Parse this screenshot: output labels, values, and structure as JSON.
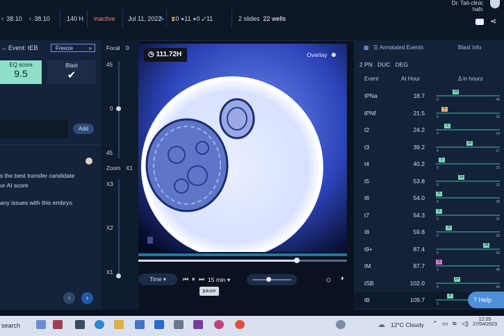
{
  "topbar": {
    "stat1": "38.10",
    "stat2": "38.10",
    "hours": "140 H",
    "status": "inactive",
    "date": "Jul 11, 2022",
    "counts": [
      "0",
      "11",
      "0",
      "11"
    ],
    "slides": "2 slides",
    "wells": "22 wells",
    "clinic": "Dr. Tait-clinic",
    "user": "hafc"
  },
  "left": {
    "event_label": "Event: tEB",
    "freeze": "Freeze",
    "eq_title": "EQ score",
    "eq_value": "9.5",
    "blast_title": "Blast",
    "add": "Add",
    "line1": "s the best transfer candidate",
    "line2": "ur AI score",
    "line3": "any issues with this embryo"
  },
  "focal": {
    "focal_label": "Focal",
    "focal_value": "0",
    "ticks": [
      "45",
      "0",
      "45"
    ],
    "zoom_label": "Zoom",
    "zoom_value": "X1",
    "zoom_ticks": [
      "X3",
      "X2",
      "X1"
    ]
  },
  "viewer": {
    "time": "111.72H",
    "overlay": "Overlay",
    "progress_fraction": 0.76
  },
  "controls": {
    "time_mode": "Time",
    "interval": "15 min",
    "tooltip": "pause"
  },
  "events_panel": {
    "tab_annotated": "Annotated Events",
    "tab_blast": "Blast Info",
    "filter_pn": "2 PN",
    "filter_duc": "DUC",
    "filter_deg": "DEG",
    "col_event": "Event",
    "col_hour": "At Hour",
    "col_delta": "Δ in hours",
    "rows": [
      {
        "event": "tPNa",
        "hour": "18.7",
        "tag": "13",
        "min": "0",
        "max": "45",
        "pos": 0.3,
        "color": "#78d6b6"
      },
      {
        "event": "tPNf",
        "hour": "21.5",
        "tag": "5",
        "min": "0",
        "max": "30",
        "pos": 0.1,
        "color": "#e0b070"
      },
      {
        "event": "t2",
        "hour": "24.2",
        "tag": "3",
        "min": "0",
        "max": "14",
        "pos": 0.15,
        "color": "#78d6b6"
      },
      {
        "event": "t3",
        "hour": "39.2",
        "tag": "15",
        "min": "0",
        "max": "27",
        "pos": 0.55,
        "color": "#78d6b6"
      },
      {
        "event": "t4",
        "hour": "40.2",
        "tag": "1",
        "min": "0",
        "max": "23",
        "pos": 0.05,
        "color": "#78d6b6"
      },
      {
        "event": "t5",
        "hour": "53.8",
        "tag": "14",
        "min": "0",
        "max": "33",
        "pos": 0.4,
        "color": "#78d6b6"
      },
      {
        "event": "t6",
        "hour": "54.0",
        "tag": "0",
        "min": "0",
        "max": "28",
        "pos": 0.0,
        "color": "#78d6b6"
      },
      {
        "event": "t7",
        "hour": "54.3",
        "tag": "0",
        "min": "0",
        "max": "31",
        "pos": 0.0,
        "color": "#78d6b6"
      },
      {
        "event": "t8",
        "hour": "59.8",
        "tag": "6",
        "min": "0",
        "max": "32",
        "pos": 0.18,
        "color": "#78d6b6"
      },
      {
        "event": "t9+",
        "hour": "87.4",
        "tag": "28",
        "min": "0",
        "max": "33",
        "pos": 0.85,
        "color": "#78d6b6"
      },
      {
        "event": "tM",
        "hour": "87.7",
        "tag": "0",
        "min": "0",
        "max": "48",
        "pos": 0.0,
        "color": "#d878c8"
      },
      {
        "event": "tSB",
        "hour": "102.0",
        "tag": "14",
        "min": "0",
        "max": "44",
        "pos": 0.32,
        "color": "#78d6b6"
      },
      {
        "event": "tB",
        "hour": "109.7",
        "tag": "8",
        "min": "0",
        "max": "",
        "pos": 0.2,
        "color": "#78d6b6"
      }
    ],
    "help": "Help"
  },
  "taskbar": {
    "search": "search",
    "weather": "12°C Cloudy",
    "time": "12:05",
    "date": "27/04/2023"
  }
}
